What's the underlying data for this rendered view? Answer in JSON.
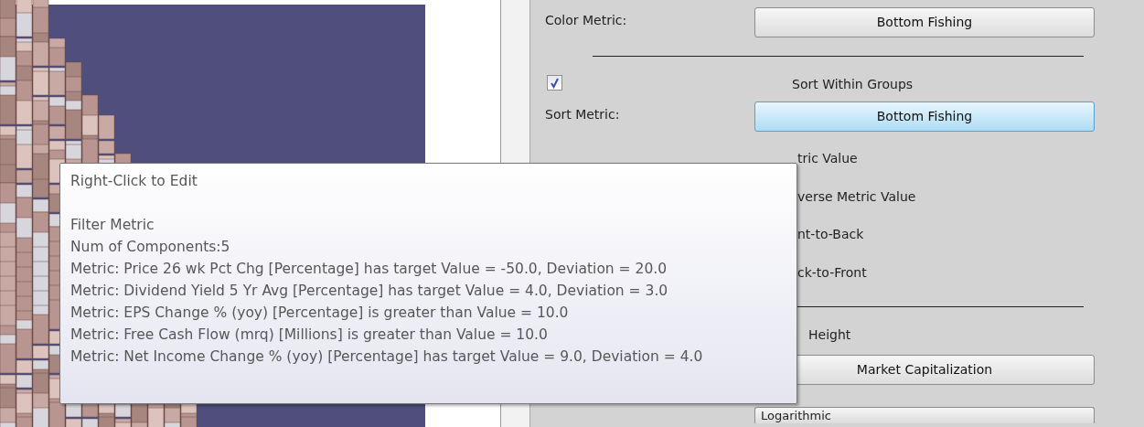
{
  "settings_panel": {
    "color_metric": {
      "label": "Color Metric:",
      "value": "Bottom Fishing"
    },
    "sort_within_groups": {
      "label": "Sort Within Groups",
      "checked": true
    },
    "sort_metric": {
      "label": "Sort Metric:",
      "value": "Bottom Fishing",
      "highlighted": true
    },
    "sort_options": [
      {
        "text": "tric Value"
      },
      {
        "text": "verse Metric Value"
      },
      {
        "text": "nt-to-Back"
      },
      {
        "text": "ck-to-Front"
      }
    ],
    "height_option": {
      "text": "Height"
    },
    "height_metric": {
      "value": "Market Capitalization"
    },
    "height_type": {
      "value": "Logarithmic"
    }
  },
  "tooltip": {
    "title": "Right-Click to Edit",
    "heading": "Filter Metric",
    "lines": [
      "Num of Components:5",
      "Metric: Price 26 wk Pct Chg [Percentage] has target Value = -50.0, Deviation = 20.0",
      "Metric: Dividend Yield 5 Yr Avg [Percentage] has target Value = 4.0, Deviation = 3.0",
      "Metric: EPS Change % (yoy) [Percentage] is greater than Value = 10.0",
      "Metric: Free Cash Flow (mrq) [Millions] is greater than Value = 10.0",
      "Metric: Net Income Change % (yoy) [Percentage] has target Value = 9.0, Deviation = 4.0"
    ]
  }
}
